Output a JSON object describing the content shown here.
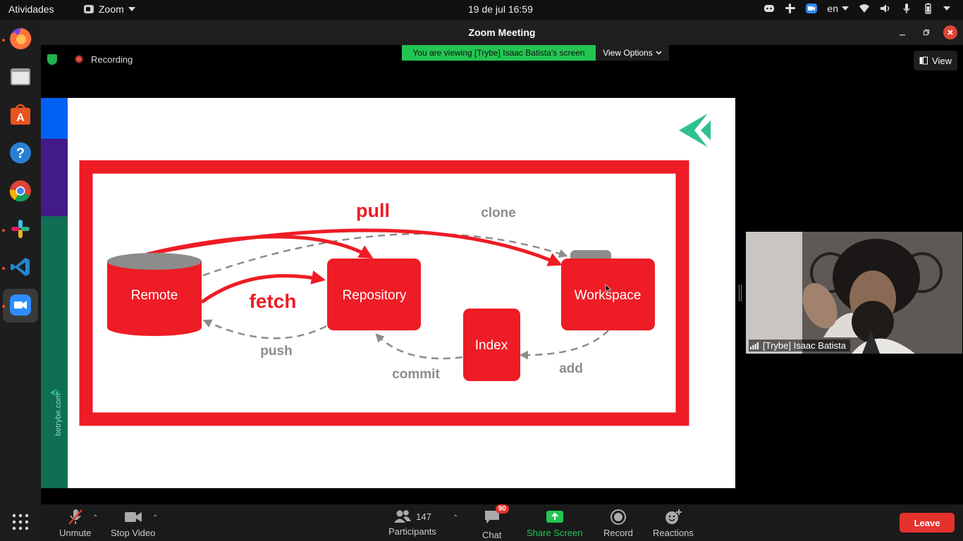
{
  "topbar": {
    "activities": "Atividades",
    "app_name": "Zoom",
    "clock": "19 de jul  16:59",
    "language": "en"
  },
  "dock": {
    "apps": [
      "firefox-icon",
      "files-icon",
      "software-icon",
      "help-icon",
      "chrome-icon",
      "slack-icon",
      "vscode-icon",
      "zoom-icon",
      "app-grid-icon"
    ]
  },
  "window": {
    "title": "Zoom Meeting"
  },
  "meeting": {
    "recording_label": "Recording",
    "viewing_banner": "You are viewing [Trybe] Isaac Batista's screen",
    "view_options": "View Options",
    "view_button": "View"
  },
  "slide": {
    "side_text": "betrybe.com",
    "diagram": {
      "nodes": {
        "remote": "Remote",
        "repository": "Repository",
        "workspace": "Workspace",
        "index": "Index"
      },
      "labels": {
        "pull": "pull",
        "clone": "clone",
        "fetch": "fetch",
        "push": "push",
        "commit": "commit",
        "add": "add"
      }
    },
    "colors": {
      "red": "#ee1c25",
      "gray": "#8c8c8c",
      "blue": "#0061f2",
      "purple": "#421b87",
      "green": "#0f6e53",
      "logo_green": "#2fc18c"
    }
  },
  "video": {
    "participant_name": "[Trybe] Isaac Batista"
  },
  "toolbar": {
    "unmute": "Unmute",
    "stop_video": "Stop Video",
    "participants": "Participants",
    "participants_count": "147",
    "chat": "Chat",
    "chat_badge": "90",
    "share_screen": "Share Screen",
    "record": "Record",
    "reactions": "Reactions",
    "leave": "Leave"
  }
}
